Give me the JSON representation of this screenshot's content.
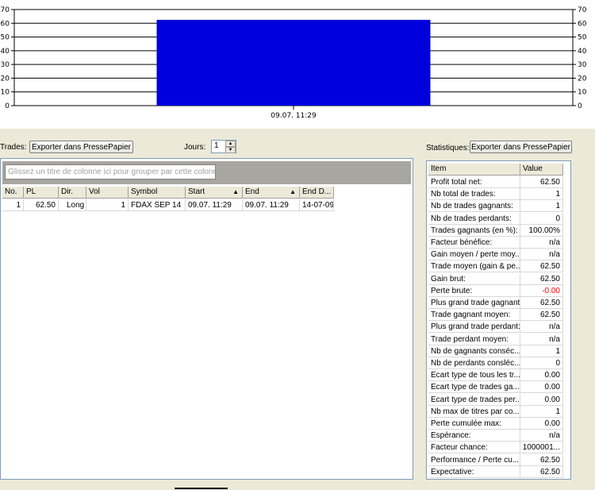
{
  "chart_data": {
    "type": "bar",
    "categories": [
      "09.07. 11:29"
    ],
    "values": [
      62.5
    ],
    "ylim": [
      0,
      70
    ],
    "yticks": [
      "0",
      "10",
      "20",
      "30",
      "40",
      "50",
      "60",
      "70"
    ],
    "bar_color": "#0000dd",
    "grid": true
  },
  "trades_panel": {
    "label": "Trades:",
    "export_button": "Exporter dans PressePapier",
    "days_label": "Jours:",
    "days_value": "1",
    "group_hint": "Glissez un titre de colonne ici pour grouper par cette colonne.",
    "columns": [
      "No.",
      "PL",
      "Dir.",
      "Vol",
      "Symbol",
      "Start",
      "End",
      "End D..."
    ],
    "rows": [
      [
        "1",
        "62.50",
        "Long",
        "1",
        "FDAX SEP 14",
        "09.07. 11:29",
        "09.07. 11:29",
        "14-07-09"
      ]
    ]
  },
  "stats_panel": {
    "label": "Statistiques:",
    "export_button": "Exporter dans PressePapier",
    "columns": [
      "Item",
      "Value"
    ],
    "rows": [
      [
        "Profit total net:",
        "62.50"
      ],
      [
        "Nb total de trades:",
        "1"
      ],
      [
        "Nb de trades gagnants:",
        "1"
      ],
      [
        "Nb de trades perdants:",
        "0"
      ],
      [
        "Trades gagnants (en %):",
        "100.00%"
      ],
      [
        "Facteur bénéfice:",
        "n/a"
      ],
      [
        "Gain moyen / perte moy...",
        "n/a"
      ],
      [
        "Trade moyen (gain & pe...",
        "62.50"
      ],
      [
        "Gain brut:",
        "62.50"
      ],
      [
        "Perte brute:",
        "-0.00"
      ],
      [
        "Plus grand trade gagnant:",
        "62.50"
      ],
      [
        "Trade gagnant moyen:",
        "62.50"
      ],
      [
        "Plus grand trade perdant:",
        "n/a"
      ],
      [
        "Trade perdant moyen:",
        "n/a"
      ],
      [
        "Nb de gagnants conséc...",
        "1"
      ],
      [
        "Nb de perdants consléc...",
        "0"
      ],
      [
        "Ecart type de tous les tr...",
        "0.00"
      ],
      [
        "Ecart type de trades ga...",
        "0.00"
      ],
      [
        "Ecart type de trades per...",
        "0.00"
      ],
      [
        "Nb max de titres par co...",
        "1"
      ],
      [
        "Perte cumulée max:",
        "0.00"
      ],
      [
        "Espérance:",
        "n/a"
      ],
      [
        "Facteur chance:",
        "1000001..."
      ],
      [
        "Performance / Perte cu...",
        "62.50"
      ],
      [
        "Expectative:",
        "62.50"
      ]
    ],
    "negative_color": "#ff0000"
  }
}
